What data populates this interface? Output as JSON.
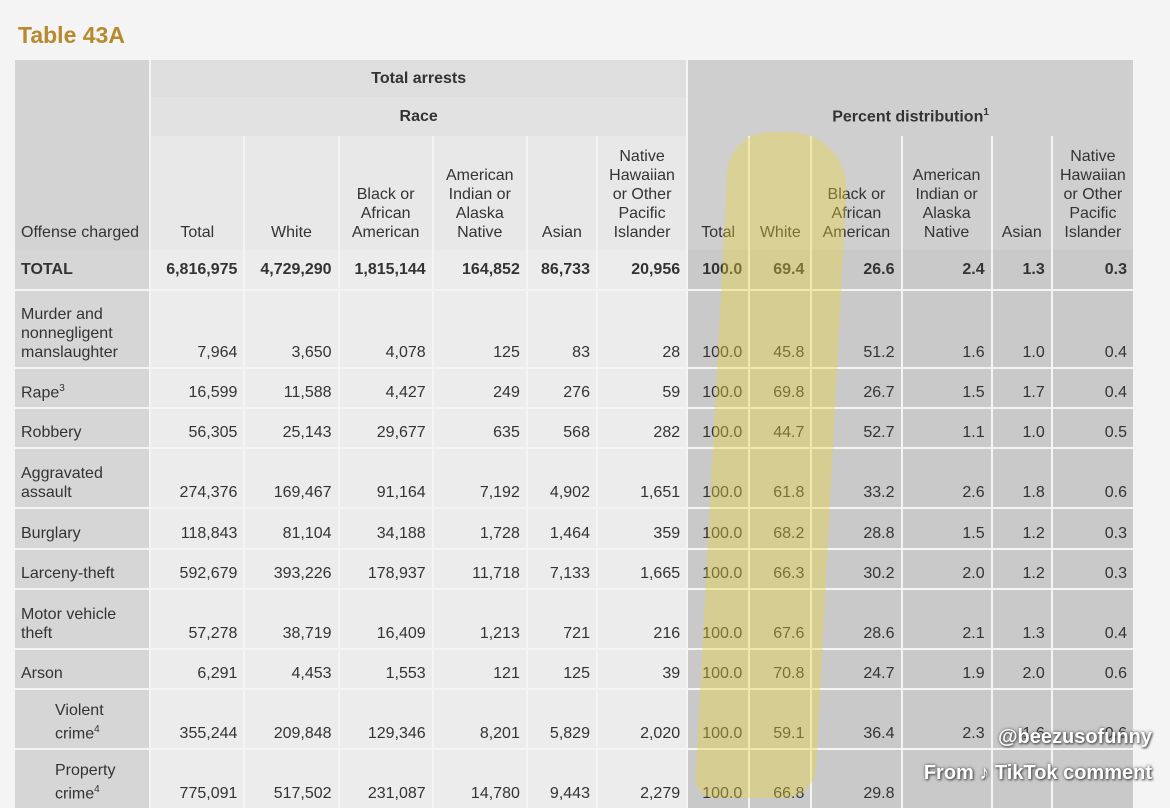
{
  "title": "Table 43A",
  "headers": {
    "total_arrests": "Total arrests",
    "race": "Race",
    "percent_distribution": "Percent distribution",
    "percent_footnote": "1",
    "offense_charged": "Offense charged",
    "col_total": "Total",
    "col_white": "White",
    "col_black": "Black or African American",
    "col_aian": "American Indian or Alaska Native",
    "col_asian": "Asian",
    "col_nhopi": "Native Hawaiian or Other Pacific Islander"
  },
  "rows": [
    {
      "offense": "TOTAL",
      "footnote": "",
      "counts": [
        "6,816,975",
        "4,729,290",
        "1,815,144",
        "164,852",
        "86,733",
        "20,956"
      ],
      "pcts": [
        "100.0",
        "69.4",
        "26.6",
        "2.4",
        "1.3",
        "0.3"
      ]
    },
    {
      "offense": "Murder and nonnegligent manslaughter",
      "footnote": "",
      "counts": [
        "7,964",
        "3,650",
        "4,078",
        "125",
        "83",
        "28"
      ],
      "pcts": [
        "100.0",
        "45.8",
        "51.2",
        "1.6",
        "1.0",
        "0.4"
      ]
    },
    {
      "offense": "Rape",
      "footnote": "3",
      "counts": [
        "16,599",
        "11,588",
        "4,427",
        "249",
        "276",
        "59"
      ],
      "pcts": [
        "100.0",
        "69.8",
        "26.7",
        "1.5",
        "1.7",
        "0.4"
      ]
    },
    {
      "offense": "Robbery",
      "footnote": "",
      "counts": [
        "56,305",
        "25,143",
        "29,677",
        "635",
        "568",
        "282"
      ],
      "pcts": [
        "100.0",
        "44.7",
        "52.7",
        "1.1",
        "1.0",
        "0.5"
      ]
    },
    {
      "offense": "Aggravated assault",
      "footnote": "",
      "counts": [
        "274,376",
        "169,467",
        "91,164",
        "7,192",
        "4,902",
        "1,651"
      ],
      "pcts": [
        "100.0",
        "61.8",
        "33.2",
        "2.6",
        "1.8",
        "0.6"
      ]
    },
    {
      "offense": "Burglary",
      "footnote": "",
      "counts": [
        "118,843",
        "81,104",
        "34,188",
        "1,728",
        "1,464",
        "359"
      ],
      "pcts": [
        "100.0",
        "68.2",
        "28.8",
        "1.5",
        "1.2",
        "0.3"
      ]
    },
    {
      "offense": "Larceny-theft",
      "footnote": "",
      "counts": [
        "592,679",
        "393,226",
        "178,937",
        "11,718",
        "7,133",
        "1,665"
      ],
      "pcts": [
        "100.0",
        "66.3",
        "30.2",
        "2.0",
        "1.2",
        "0.3"
      ]
    },
    {
      "offense": "Motor vehicle theft",
      "footnote": "",
      "counts": [
        "57,278",
        "38,719",
        "16,409",
        "1,213",
        "721",
        "216"
      ],
      "pcts": [
        "100.0",
        "67.6",
        "28.6",
        "2.1",
        "1.3",
        "0.4"
      ]
    },
    {
      "offense": "Arson",
      "footnote": "",
      "counts": [
        "6,291",
        "4,453",
        "1,553",
        "121",
        "125",
        "39"
      ],
      "pcts": [
        "100.0",
        "70.8",
        "24.7",
        "1.9",
        "2.0",
        "0.6"
      ]
    },
    {
      "offense": "Violent crime",
      "footnote": "4",
      "counts": [
        "355,244",
        "209,848",
        "129,346",
        "8,201",
        "5,829",
        "2,020"
      ],
      "pcts": [
        "100.0",
        "59.1",
        "36.4",
        "2.3",
        "1.6",
        "0.6"
      ]
    },
    {
      "offense": "Property crime",
      "footnote": "4",
      "counts": [
        "775,091",
        "517,502",
        "231,087",
        "14,780",
        "9,443",
        "2,279"
      ],
      "pcts": [
        "100.0",
        "66.8",
        "29.8",
        "",
        "",
        ""
      ]
    }
  ],
  "watermark": {
    "user": "@beezusofunny",
    "from": "From ♪ TikTok comment"
  },
  "colors": {
    "title": "#b88a2e",
    "highlight": "#ecd63c"
  }
}
